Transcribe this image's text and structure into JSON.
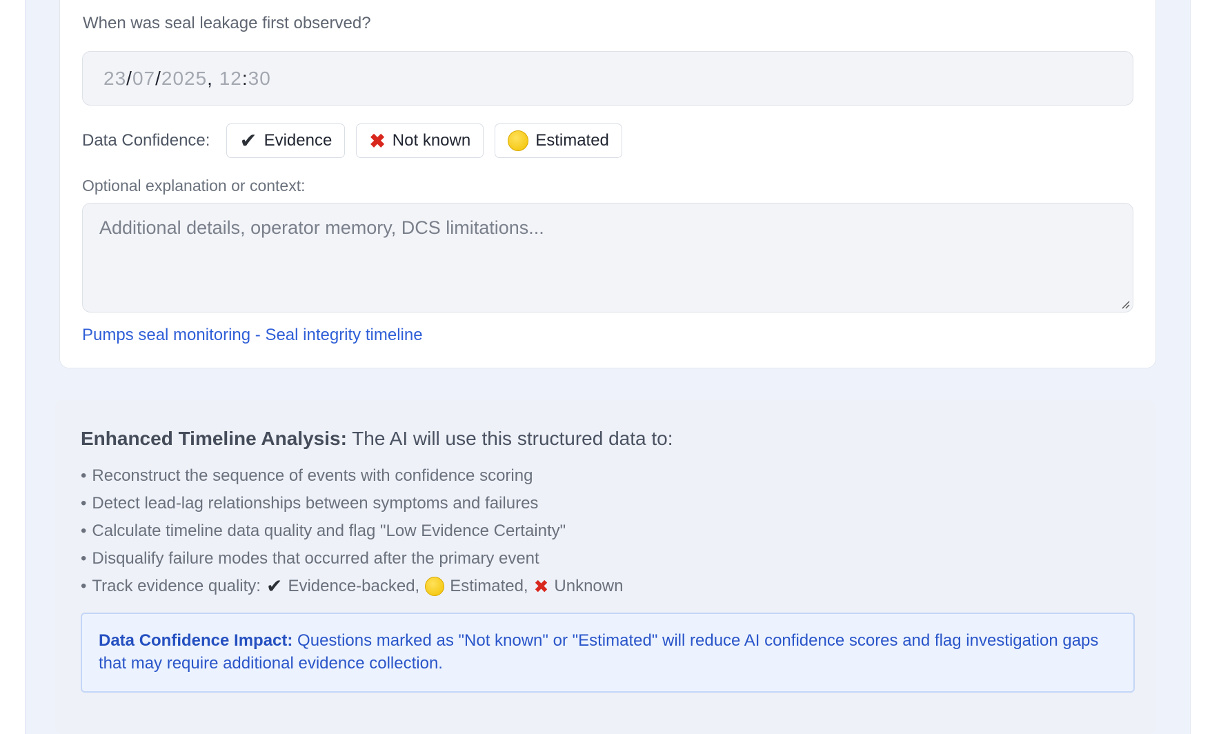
{
  "question": {
    "label": "When was seal leakage first observed?",
    "date": {
      "day": "23",
      "month": "07",
      "year": "2025",
      "hour": "12",
      "minute": "30"
    }
  },
  "confidence": {
    "label": "Data Confidence:",
    "options": [
      {
        "label": "Evidence",
        "icon": "check-icon"
      },
      {
        "label": "Not known",
        "icon": "cross-icon"
      },
      {
        "label": "Estimated",
        "icon": "yellow-circle-icon"
      }
    ]
  },
  "explanation": {
    "label": "Optional explanation or context:",
    "placeholder": "Additional details, operator memory, DCS limitations..."
  },
  "card_link": "Pumps seal monitoring - Seal integrity timeline",
  "analysis": {
    "title_bold": "Enhanced Timeline Analysis:",
    "title_rest": " The AI will use this structured data to:",
    "bullets": [
      "Reconstruct the sequence of events with confidence scoring",
      "Detect lead-lag relationships between symptoms and failures",
      "Calculate timeline data quality and flag \"Low Evidence Certainty\"",
      "Disqualify failure modes that occurred after the primary event"
    ],
    "track": {
      "prefix": "Track evidence quality:",
      "evidence": "Evidence-backed,",
      "estimated": "Estimated,",
      "unknown": "Unknown"
    }
  },
  "impact": {
    "title": "Data Confidence Impact:",
    "text": " Questions marked as \"Not known\" or \"Estimated\" will reduce AI confidence scores and flag investigation gaps that may require additional evidence collection."
  },
  "colors": {
    "link": "#2f5fd7",
    "impact_bg": "#ecf3ff",
    "impact_border": "#c4d6f7",
    "cross_red": "#d8281e",
    "estimated_yellow": "#f2c200"
  }
}
